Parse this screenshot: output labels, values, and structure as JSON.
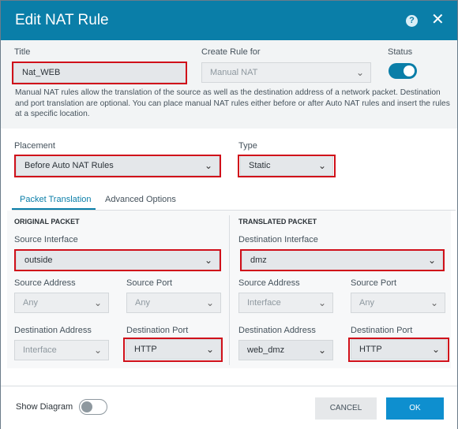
{
  "header": {
    "title": "Edit NAT Rule",
    "help_symbol": "?",
    "close_symbol": "✕"
  },
  "top": {
    "title_label": "Title",
    "title_value": "Nat_WEB",
    "create_rule_label": "Create Rule for",
    "create_rule_value": "Manual NAT",
    "status_label": "Status",
    "status_on": true,
    "description": "Manual NAT rules allow the translation of the source as well as the destination address of a network packet. Destination and port translation are optional. You can place manual NAT rules either before or after Auto NAT rules and insert the rules at a specific location."
  },
  "placement": {
    "label": "Placement",
    "value": "Before Auto NAT Rules"
  },
  "type": {
    "label": "Type",
    "value": "Static"
  },
  "tabs": [
    {
      "label": "Packet Translation",
      "active": true
    },
    {
      "label": "Advanced Options",
      "active": false
    }
  ],
  "original": {
    "title": "ORIGINAL PACKET",
    "source_interface": {
      "label": "Source Interface",
      "value": "outside"
    },
    "source_address": {
      "label": "Source Address",
      "value": "Any"
    },
    "source_port": {
      "label": "Source Port",
      "value": "Any"
    },
    "destination_address": {
      "label": "Destination Address",
      "value": "Interface"
    },
    "destination_port": {
      "label": "Destination Port",
      "value": "HTTP"
    }
  },
  "translated": {
    "title": "TRANSLATED PACKET",
    "destination_interface": {
      "label": "Destination Interface",
      "value": "dmz"
    },
    "source_address": {
      "label": "Source Address",
      "value": "Interface"
    },
    "source_port": {
      "label": "Source Port",
      "value": "Any"
    },
    "destination_address": {
      "label": "Destination Address",
      "value": "web_dmz"
    },
    "destination_port": {
      "label": "Destination Port",
      "value": "HTTP"
    }
  },
  "footer": {
    "show_diagram_label": "Show Diagram",
    "show_diagram_on": false,
    "cancel_label": "CANCEL",
    "ok_label": "OK"
  },
  "colors": {
    "header": "#0a7ea8",
    "highlight": "#d0101a",
    "ok_button": "#0e8fcf"
  },
  "icons": {
    "dropdown": "chevron-down-icon",
    "help": "help-icon",
    "close": "close-icon"
  }
}
